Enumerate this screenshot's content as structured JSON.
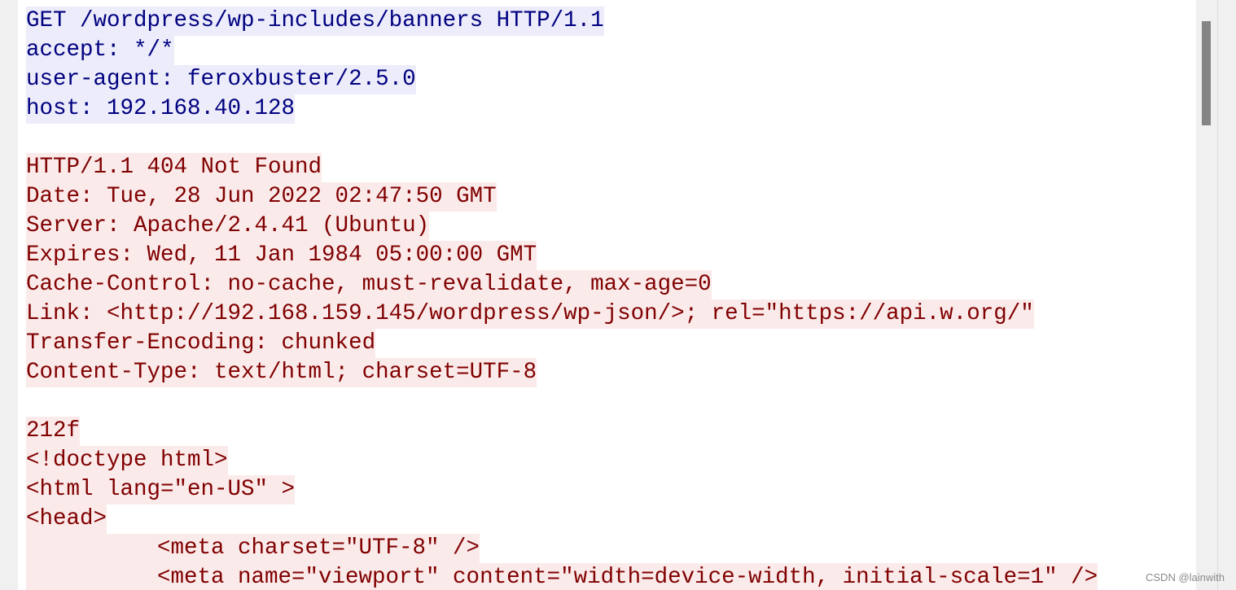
{
  "stream": {
    "request_lines": [
      "GET /wordpress/wp-includes/banners HTTP/1.1",
      "accept: */*",
      "user-agent: feroxbuster/2.5.0",
      "host: 192.168.40.128"
    ],
    "response_header_lines": [
      "HTTP/1.1 404 Not Found",
      "Date: Tue, 28 Jun 2022 02:47:50 GMT",
      "Server: Apache/2.4.41 (Ubuntu)",
      "Expires: Wed, 11 Jan 1984 05:00:00 GMT",
      "Cache-Control: no-cache, must-revalidate, max-age=0",
      "Link: <http://192.168.159.145/wordpress/wp-json/>; rel=\"https://api.w.org/\"",
      "Transfer-Encoding: chunked",
      "Content-Type: text/html; charset=UTF-8"
    ],
    "response_body_lines": [
      "212f",
      "<!doctype html>",
      "<html lang=\"en-US\" >",
      "<head>",
      "\t<meta charset=\"UTF-8\" />",
      "\t<meta name=\"viewport\" content=\"width=device-width, initial-scale=1\" />"
    ]
  },
  "colors": {
    "client_text": "#000080",
    "client_bg": "#ececfa",
    "server_text": "#800000",
    "server_bg": "#fbeaea"
  },
  "watermark": "CSDN @lainwith"
}
